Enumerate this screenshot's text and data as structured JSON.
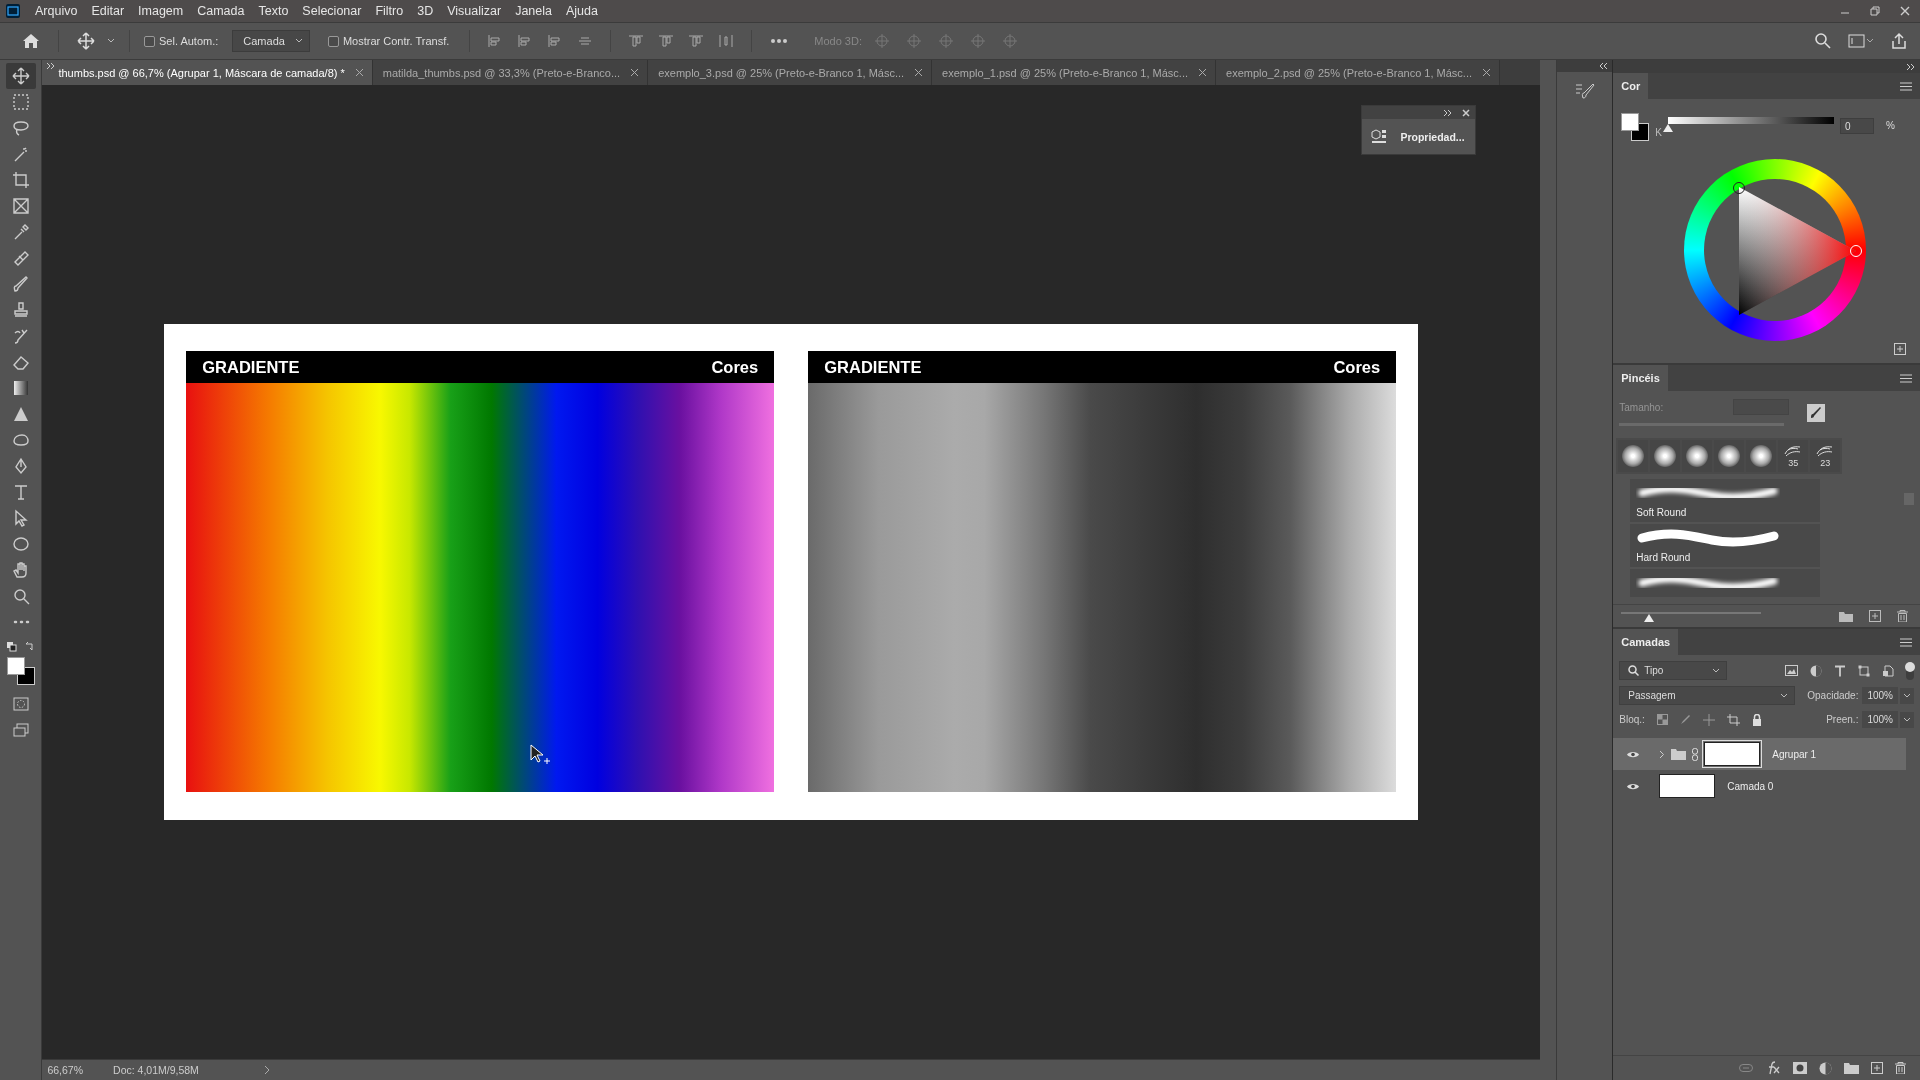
{
  "menu": [
    "Arquivo",
    "Editar",
    "Imagem",
    "Camada",
    "Texto",
    "Selecionar",
    "Filtro",
    "3D",
    "Visualizar",
    "Janela",
    "Ajuda"
  ],
  "options_bar": {
    "auto_select": {
      "label": "Sel. Autom.:",
      "checked": false
    },
    "target": "Camada",
    "show_transform": {
      "label": "Mostrar Contr. Transf.",
      "checked": false
    },
    "mode_3d": "Modo 3D:"
  },
  "tabs": [
    {
      "label": "thumbs.psd @ 66,7% (Agrupar 1, Máscara de camada/8) *",
      "selected": true
    },
    {
      "label": "matilda_thumbs.psd @ 33,3% (Preto-e-Branco...",
      "selected": false
    },
    {
      "label": "exemplo_3.psd @ 25% (Preto-e-Branco 1, Másc...",
      "selected": false
    },
    {
      "label": "exemplo_1.psd @ 25% (Preto-e-Branco 1, Másc...",
      "selected": false
    },
    {
      "label": "exemplo_2.psd @ 25% (Preto-e-Branco 1, Másc...",
      "selected": false
    }
  ],
  "tools": [
    {
      "kind": "move",
      "selected": true
    },
    {
      "kind": "marquee",
      "selected": false
    },
    {
      "kind": "lasso",
      "selected": false
    },
    {
      "kind": "wand",
      "selected": false
    },
    {
      "kind": "crop",
      "selected": false
    },
    {
      "kind": "frame",
      "selected": false
    },
    {
      "kind": "eyedropper",
      "selected": false
    },
    {
      "kind": "heal",
      "selected": false
    },
    {
      "kind": "brush",
      "selected": false
    },
    {
      "kind": "stamp",
      "selected": false
    },
    {
      "kind": "history",
      "selected": false
    },
    {
      "kind": "eraser",
      "selected": false
    },
    {
      "kind": "gradient",
      "selected": false
    },
    {
      "kind": "blur",
      "selected": false
    },
    {
      "kind": "dodge",
      "selected": false
    },
    {
      "kind": "pen",
      "selected": false
    },
    {
      "kind": "type",
      "selected": false
    },
    {
      "kind": "select",
      "selected": false
    },
    {
      "kind": "ellipse",
      "selected": false
    },
    {
      "kind": "hand",
      "selected": false
    },
    {
      "kind": "zoom",
      "selected": false
    },
    {
      "kind": "more",
      "selected": false
    }
  ],
  "document": {
    "panels": [
      {
        "title": "GRADIENTE",
        "label": "Cores",
        "kind": "color"
      },
      {
        "title": "GRADIENTE",
        "label": "Cores",
        "kind": "gray"
      }
    ]
  },
  "properties_float": {
    "title": "Propriedad..."
  },
  "color_panel": {
    "tab": "Cor",
    "channel": "K",
    "value": "0",
    "unit": "%",
    "level": 0
  },
  "brushes_panel": {
    "tab": "Pincéis",
    "size_label": "Tamanho:",
    "presets": [
      {
        "kind": "soft"
      },
      {
        "kind": "soft"
      },
      {
        "kind": "soft"
      },
      {
        "kind": "soft"
      },
      {
        "kind": "soft"
      },
      {
        "kind": "textured",
        "size": "35"
      },
      {
        "kind": "textured",
        "size": "23"
      }
    ],
    "brushes": [
      {
        "name": "Soft Round",
        "kind": "soft"
      },
      {
        "name": "Hard Round",
        "kind": "hard"
      },
      {
        "kind": "soft"
      }
    ],
    "level": 0.2
  },
  "layers_panel": {
    "tab": "Camadas",
    "filter": "Tipo",
    "blend": "Passagem",
    "opacity_label": "Opacidade:",
    "opacity": "100%",
    "lock_label": "Bloq.:",
    "fill_label": "Preen.:",
    "fill": "100%",
    "layers": [
      {
        "name": "Agrupar 1",
        "kind": "group",
        "visible": true,
        "selected": true
      },
      {
        "name": "Camada 0",
        "kind": "layer",
        "visible": true,
        "selected": false
      }
    ]
  },
  "status_bar": {
    "zoom": "66,67%",
    "doc": "Doc: 4,01M/9,58M"
  }
}
